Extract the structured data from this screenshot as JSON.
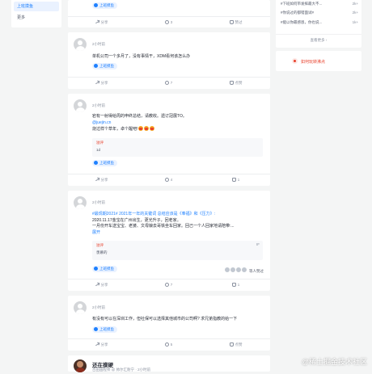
{
  "left_nav": {
    "items": [
      {
        "label": "上班摸鱼",
        "active": true
      },
      {
        "label": "更多",
        "active": false
      }
    ]
  },
  "feed": {
    "first_card_actions": {
      "share": "分享",
      "comment": "3",
      "like": "赞过"
    },
    "posts": [
      {
        "time": "2小时前",
        "text_lines": [
          "单机公司一个多月了，没有事情干，XDM看何该怎么办"
        ],
        "topic": "上班摸鱼",
        "actions": {
          "share": "分享",
          "comment": "7",
          "like": "点赞"
        }
      },
      {
        "time": "2小时前",
        "text_lines": [
          "宕有一射得给周的申终总结，请教收。遗订冠展TO。",
          "@juejin.cn",
          "烧过样个草年，卓个醒吧!"
        ],
        "comment": {
          "label": "溢评",
          "text": "1d"
        },
        "topic": "上班摸鱼",
        "actions": {
          "share": "分享",
          "comment": "4",
          "like": "1"
        }
      },
      {
        "time": "2小时前",
        "text_lines": [
          "#最现期2021# 2021年一年的关键词 总结应该是《奉福》和《压力》:",
          "2020.11.17金宝在广州出生，更光升子，回老家。",
          "一月份开车送宝宝、老婆、文母娘去哥铁坐车回家。回己一个人回家地请陪带:...",
          "展开"
        ],
        "comment": {
          "label": "溢评",
          "text": "羡慕的",
          "badge": "IF"
        },
        "readers": "等人赞过",
        "topic": "上班摸鱼",
        "actions": {
          "share": "分享",
          "comment": "7",
          "like": "1"
        }
      },
      {
        "time": "2小时前",
        "text_lines": [
          "有没有可以在深圳工作，但社保可以选择其他城市的公司啊? 求兄弟指教的给一下"
        ],
        "topic": "上班摸鱼",
        "actions": {
          "share": "分享",
          "comment": "5",
          "like": "点赞"
        }
      },
      {
        "author": "还在摸硬",
        "author_meta": "百田画程师 @ 帅尔汇耐宁 · 2小时前"
      }
    ]
  },
  "right": {
    "hot": [
      {
        "title": "#下班如何带发挥最大不...",
        "value": "2k+"
      },
      {
        "title": "#你说过的都错面试#",
        "value": "2k+"
      },
      {
        "title": "#能以你最感恩，你也说...",
        "value": "1k+"
      }
    ],
    "view_more": "查看更多 ›",
    "hint": "如何玩转沸点"
  },
  "watermark": "@稀土掘金技术社区"
}
